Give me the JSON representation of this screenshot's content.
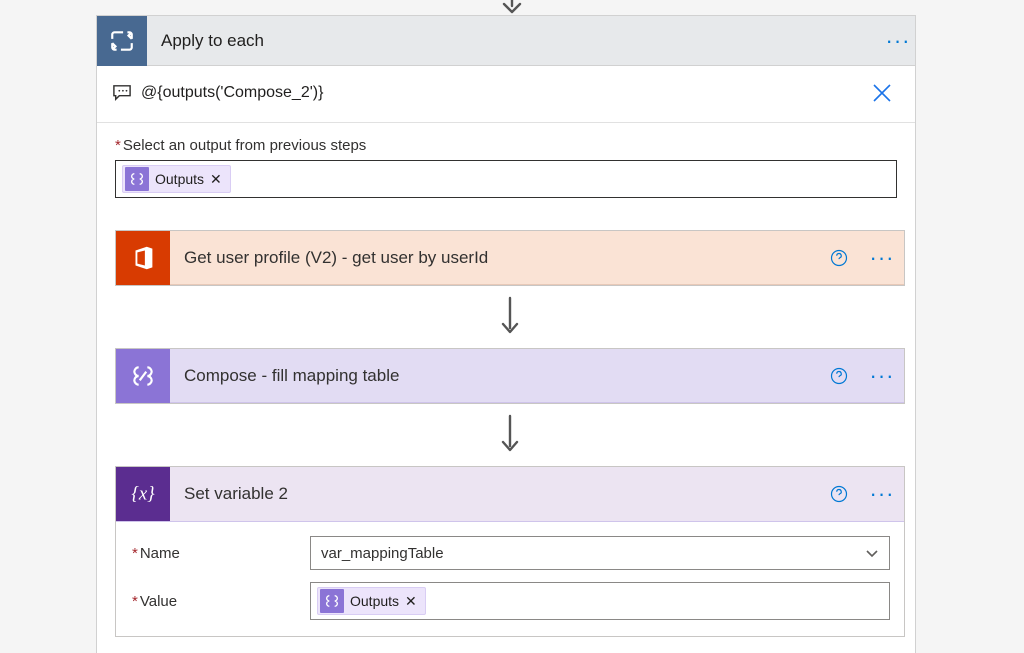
{
  "outer": {
    "title": "Apply to each"
  },
  "peek": {
    "expression": "@{outputs('Compose_2')}"
  },
  "from_field": {
    "label": "Select an output from previous steps",
    "token_label": "Outputs"
  },
  "actions": {
    "office": {
      "title": "Get user profile (V2) - get user by userId"
    },
    "compose": {
      "title": "Compose - fill mapping table"
    },
    "setvar": {
      "title": "Set variable 2",
      "name_label": "Name",
      "name_value": "var_mappingTable",
      "value_label": "Value",
      "value_token": "Outputs"
    }
  }
}
